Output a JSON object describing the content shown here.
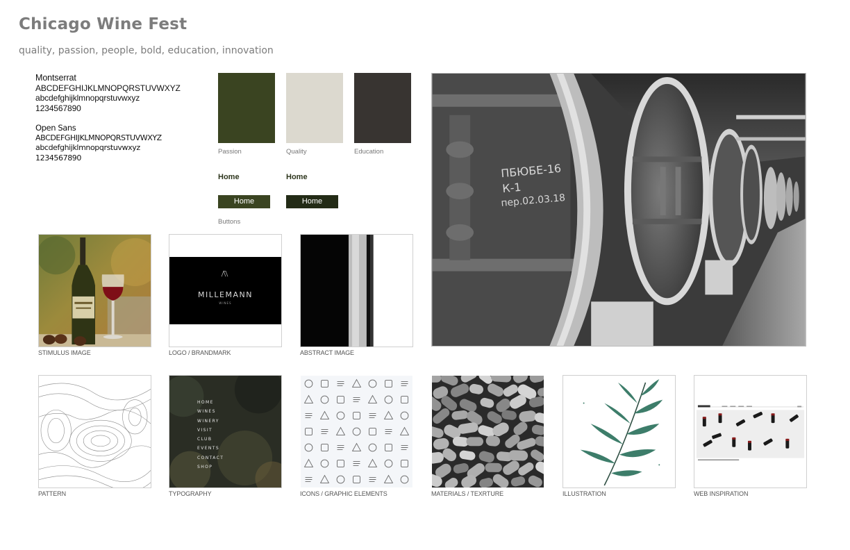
{
  "header": {
    "title": "Chicago Wine Fest",
    "tagline": "quality, passion, people, bold, education, innovation"
  },
  "typography_spec": {
    "primary": {
      "name": "Montserrat",
      "upper": "ABCDEFGHIJKLMNOPQRSTUVWXYZ",
      "lower": "abcdefghijklmnopqrstuvwxyz",
      "digits": "1234567890"
    },
    "secondary": {
      "name": "Open Sans",
      "upper": "ABCDEFGHIJKLMNOPQRSTUVWXYZ",
      "lower": "abcdefghijklmnopqrstuvwxyz",
      "digits": "1234567890"
    }
  },
  "palette": [
    {
      "label": "Passion",
      "color": "#3a4421"
    },
    {
      "label": "Quality",
      "color": "#dcd9cf"
    },
    {
      "label": "Education",
      "color": "#383431"
    }
  ],
  "buttons": {
    "link_1": "Home",
    "link_2": "Home",
    "button_1": "Home",
    "button_2": "Home",
    "button_1_color": "#3a4421",
    "button_2_color": "#232b16",
    "label": "Buttons"
  },
  "tiles_row1": [
    {
      "label": "STIMULUS IMAGE"
    },
    {
      "label": "LOGO / BRANDMARK",
      "logo_name": "MILLEMANN",
      "logo_sub": "WINES"
    },
    {
      "label": "ABSTRACT IMAGE"
    }
  ],
  "tiles_row2": [
    {
      "label": "PATTERN"
    },
    {
      "label": "TYPOGRAPHY",
      "menu": [
        "HOME",
        "WINES",
        "WINERY",
        "VISIT",
        "CLUB",
        "EVENTS",
        "CONTACT",
        "SHOP"
      ]
    },
    {
      "label": "ICONS / GRAPHIC ELEMENTS"
    },
    {
      "label": "MATERIALS / TEXRTURE"
    },
    {
      "label": "ILLUSTRATION"
    },
    {
      "label": "WEB INSPIRATION"
    }
  ],
  "hero": {
    "chalk_1": "ПБЮБЕ-16",
    "chalk_2": "К-1",
    "chalk_3": "пер.02.03.18"
  }
}
